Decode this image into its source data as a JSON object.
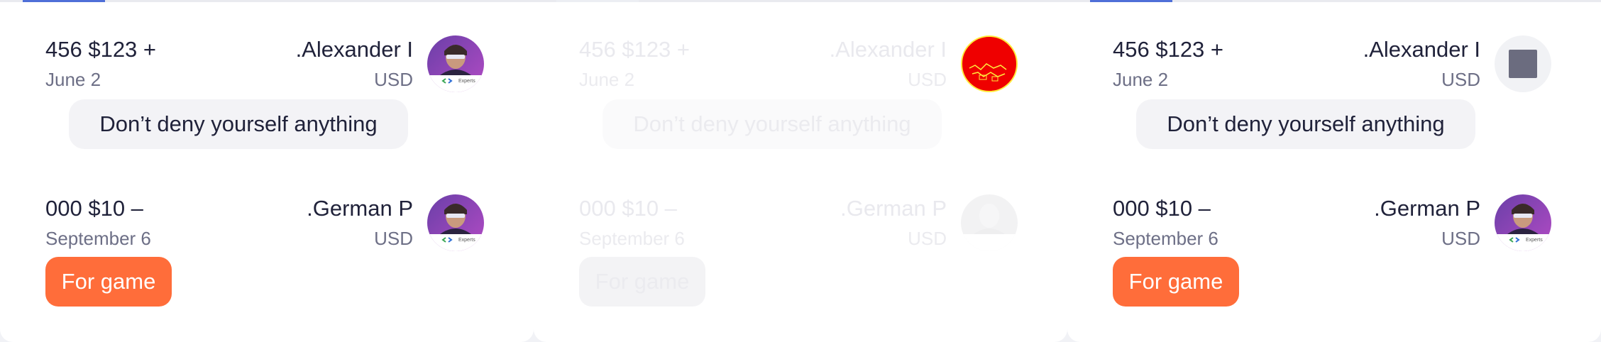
{
  "colors": {
    "accent": "#4f6fd8",
    "tag_orange": "#ff6d3a",
    "text_primary": "#20223a",
    "text_secondary": "#6d6f86",
    "bubble_bg": "#f3f3f6",
    "broken_image_red": "#ef0000"
  },
  "panels": [
    {
      "state": "loaded",
      "entries": [
        {
          "amount": "456 $123 +",
          "name": ".Alexander I",
          "date": "June 2",
          "currency": "USD",
          "avatar": "user-photo",
          "avatar_caption": "Experts",
          "message": "Don’t deny yourself anything"
        },
        {
          "amount": "000 $10 –",
          "name": ".German P",
          "date": "September 6",
          "currency": "USD",
          "avatar": "user-photo",
          "avatar_caption": "Experts",
          "tag": "For game"
        }
      ]
    },
    {
      "state": "loading-skeleton",
      "entries": [
        {
          "amount": "456 $123 +",
          "name": ".Alexander I",
          "date": "June 2",
          "currency": "USD",
          "avatar": "broken-image-red",
          "message": "Don’t deny yourself anything"
        },
        {
          "amount": "000 $10 –",
          "name": ".German P",
          "date": "September 6",
          "currency": "USD",
          "avatar": "faded-photo",
          "tag": "For game"
        }
      ]
    },
    {
      "state": "loaded-placeholder-avatar",
      "entries": [
        {
          "amount": "456 $123 +",
          "name": ".Alexander I",
          "date": "June 2",
          "currency": "USD",
          "avatar": "image-placeholder",
          "message": "Don’t deny yourself anything"
        },
        {
          "amount": "000 $10 –",
          "name": ".German P",
          "date": "September 6",
          "currency": "USD",
          "avatar": "user-photo",
          "avatar_caption": "Experts",
          "tag": "For game"
        }
      ]
    }
  ]
}
